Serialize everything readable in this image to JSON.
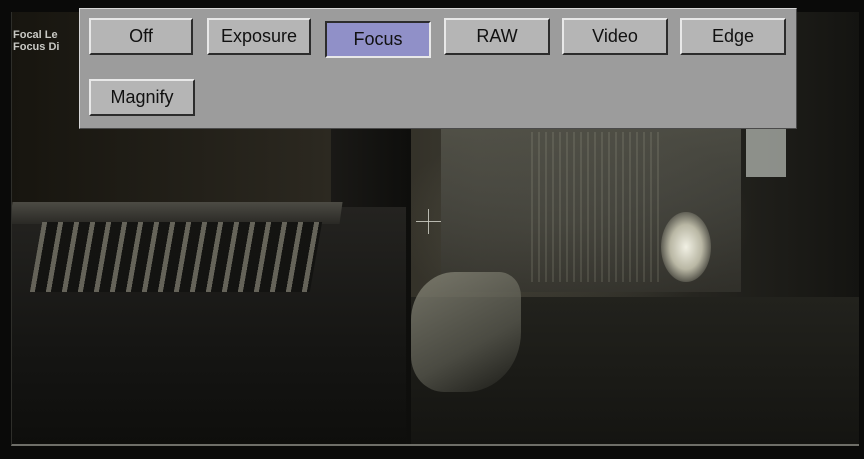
{
  "overlay_info": {
    "focal_length_label": "Focal Le",
    "focus_distance_label": "Focus Di"
  },
  "mode_menu": {
    "buttons": [
      {
        "label": "Off",
        "active": false
      },
      {
        "label": "Exposure",
        "active": false
      },
      {
        "label": "Focus",
        "active": true
      },
      {
        "label": "RAW",
        "active": false
      },
      {
        "label": "Video",
        "active": false
      },
      {
        "label": "Edge",
        "active": false
      },
      {
        "label": "Magnify",
        "active": false
      }
    ],
    "colors": {
      "panel": "#9c9c9c",
      "button": "#b5b5b5",
      "active_button": "#9090c8"
    }
  },
  "viewfinder": {
    "crosshair_icon": "crosshair-icon"
  }
}
